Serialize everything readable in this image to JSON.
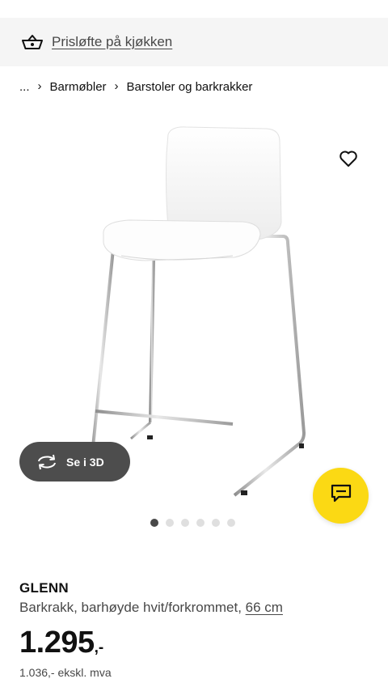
{
  "promo": {
    "text": "Prisløfte på kjøkken",
    "icon": "basket-icon"
  },
  "breadcrumb": {
    "ellipsis": "...",
    "items": [
      {
        "label": "Barmøbler"
      },
      {
        "label": "Barstoler og barkrakker"
      }
    ]
  },
  "gallery": {
    "view3d_label": "Se i 3D",
    "dot_count": 6,
    "active_dot": 1
  },
  "product": {
    "name": "GLENN",
    "description": "Barkrakk, barhøyde hvit/forkrommet, ",
    "size_link": "66 cm",
    "price_main": "1.295",
    "price_suffix": ",-",
    "price_ex_vat": "1.036,- ekskl. mva"
  },
  "colors": {
    "accent_yellow": "#fbd914",
    "dark_pill": "#4d4d4d",
    "banner_bg": "#f5f5f5"
  }
}
